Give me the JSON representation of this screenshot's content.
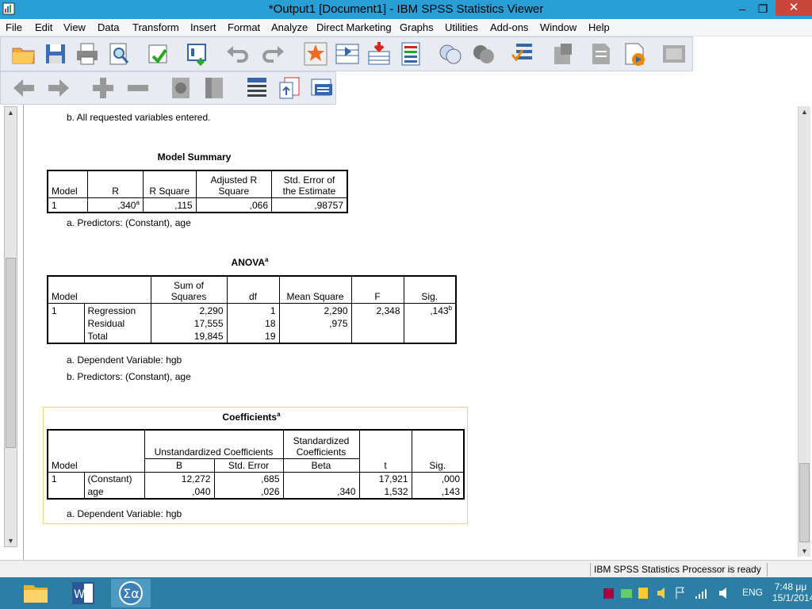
{
  "window": {
    "title": "*Output1 [Document1] - IBM SPSS Statistics Viewer",
    "minimize": "–",
    "restore": "❐",
    "close": "✕"
  },
  "menu": [
    "File",
    "Edit",
    "View",
    "Data",
    "Transform",
    "Insert",
    "Format",
    "Analyze",
    "Direct Marketing",
    "Graphs",
    "Utilities",
    "Add-ons",
    "Window",
    "Help"
  ],
  "note_top": "b. All requested variables entered.",
  "model_summary": {
    "title": "Model Summary",
    "headers": {
      "model": "Model",
      "r": "R",
      "r_square": "R Square",
      "adj1": "Adjusted R",
      "adj2": "Square",
      "se1": "Std. Error of",
      "se2": "the Estimate"
    },
    "row": {
      "model": "1",
      "r": ",340",
      "r_sup": "a",
      "r_square": ",115",
      "adj": ",066",
      "se": ",98757"
    },
    "note": "a. Predictors: (Constant), age"
  },
  "anova": {
    "title": "ANOVA",
    "title_sup": "a",
    "headers": {
      "model": "Model",
      "ss1": "Sum of",
      "ss2": "Squares",
      "df": "df",
      "ms": "Mean Square",
      "f": "F",
      "sig": "Sig."
    },
    "rows": [
      {
        "model": "1",
        "label": "Regression",
        "ss": "2,290",
        "df": "1",
        "ms": "2,290",
        "f": "2,348",
        "sig": ",143",
        "sig_sup": "b"
      },
      {
        "model": "",
        "label": "Residual",
        "ss": "17,555",
        "df": "18",
        "ms": ",975",
        "f": "",
        "sig": ""
      },
      {
        "model": "",
        "label": "Total",
        "ss": "19,845",
        "df": "19",
        "ms": "",
        "f": "",
        "sig": ""
      }
    ],
    "note_a": "a. Dependent Variable: hgb",
    "note_b": "b. Predictors: (Constant), age"
  },
  "coefficients": {
    "title": "Coefficients",
    "title_sup": "a",
    "headers": {
      "model": "Model",
      "unstd": "Unstandardized Coefficients",
      "std1": "Standardized",
      "std2": "Coefficients",
      "b": "B",
      "se": "Std. Error",
      "beta": "Beta",
      "t": "t",
      "sig": "Sig."
    },
    "rows": [
      {
        "model": "1",
        "label": "(Constant)",
        "b": "12,272",
        "se": ",685",
        "beta": "",
        "t": "17,921",
        "sig": ",000"
      },
      {
        "model": "",
        "label": "age",
        "b": ",040",
        "se": ",026",
        "beta": ",340",
        "t": "1,532",
        "sig": ",143"
      }
    ],
    "note": "a. Dependent Variable: hgb"
  },
  "status": {
    "text": "IBM SPSS Statistics Processor is ready"
  },
  "tray": {
    "lang": "ENG",
    "time": "7:48 μμ",
    "date": "15/1/2014"
  },
  "colors": {
    "titlebar": "#2a9fd6",
    "close": "#c9463d",
    "taskbar": "#2c7ea5",
    "selection_border": "#f0d870"
  }
}
